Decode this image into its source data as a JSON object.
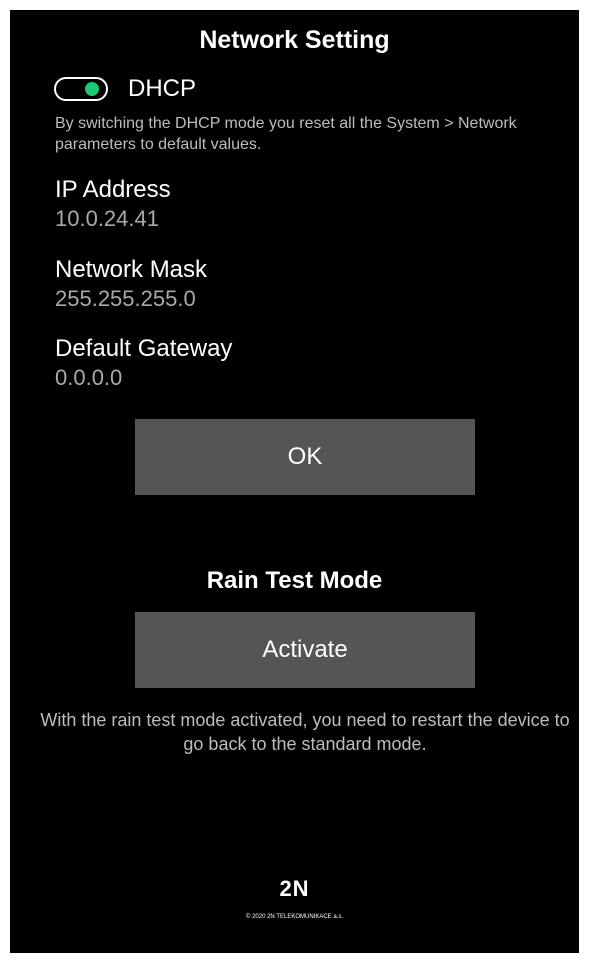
{
  "page": {
    "title": "Network Setting"
  },
  "dhcp": {
    "label": "DHCP",
    "enabled": true,
    "toggle_on_color": "#1ec773",
    "hint": "By switching the DHCP mode you reset all the System > Network parameters to default values."
  },
  "fields": {
    "ip_address": {
      "label": "IP Address",
      "value": "10.0.24.41"
    },
    "network_mask": {
      "label": "Network Mask",
      "value": "255.255.255.0"
    },
    "default_gateway": {
      "label": "Default Gateway",
      "value": "0.0.0.0"
    }
  },
  "ok_button": {
    "label": "OK"
  },
  "rain_test": {
    "title": "Rain Test Mode",
    "button_label": "Activate",
    "note": "With the rain test mode activated, you need to restart the device to go back to the standard mode."
  },
  "footer": {
    "logo": "2N",
    "copyright": "© 2020 2N TELEKOMUNIKACE a.s."
  },
  "colors": {
    "background": "#000000",
    "button": "#555555",
    "value_text": "#a9a9a9"
  }
}
